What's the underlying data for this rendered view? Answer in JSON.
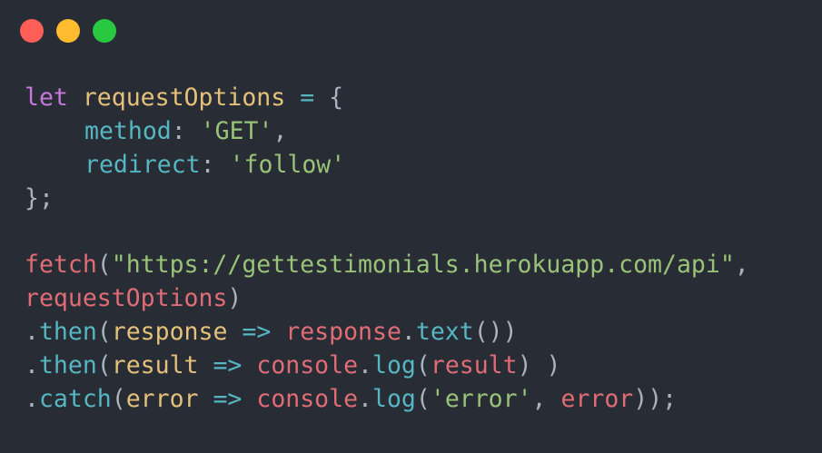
{
  "window": {
    "controls": [
      {
        "name": "close",
        "color": "#ff5f57"
      },
      {
        "name": "minimize",
        "color": "#febc2e"
      },
      {
        "name": "maximize",
        "color": "#28c840"
      }
    ]
  },
  "theme": {
    "background": "#282c34",
    "keyword": "#c678dd",
    "variable": "#e5c07b",
    "property": "#56b6c2",
    "string": "#98c379",
    "function": "#e06c75",
    "punctuation": "#abb2bf"
  },
  "code": {
    "line1": {
      "kw": "let",
      "var": "requestOptions",
      "op": "=",
      "brace": "{"
    },
    "line2": {
      "prop": "method",
      "colon": ":",
      "str": "'GET'",
      "comma": ","
    },
    "line3": {
      "prop": "redirect",
      "colon": ":",
      "str": "'follow'"
    },
    "line4": {
      "close": "};"
    },
    "line6": {
      "fn": "fetch",
      "open": "(",
      "str": "\"https://gettestimonials.herokuapp.com/api\"",
      "comma": ","
    },
    "line7": {
      "ref": "requestOptions",
      "close": ")"
    },
    "line8": {
      "dot": ".",
      "meth": "then",
      "open": "(",
      "param": "response",
      "arrow": "=>",
      "ref": "response",
      "dot2": ".",
      "meth2": "text",
      "call": "()",
      "close": ")"
    },
    "line9": {
      "dot": ".",
      "meth": "then",
      "open": "(",
      "param": "result",
      "arrow": "=>",
      "ref": "console",
      "dot2": ".",
      "meth2": "log",
      "open2": "(",
      "ref2": "result",
      "close": ") )"
    },
    "line10": {
      "dot": ".",
      "meth": "catch",
      "open": "(",
      "param": "error",
      "arrow": "=>",
      "ref": "console",
      "dot2": ".",
      "meth2": "log",
      "open2": "(",
      "str": "'error'",
      "comma": ",",
      "ref2": "error",
      "close": "));"
    }
  }
}
